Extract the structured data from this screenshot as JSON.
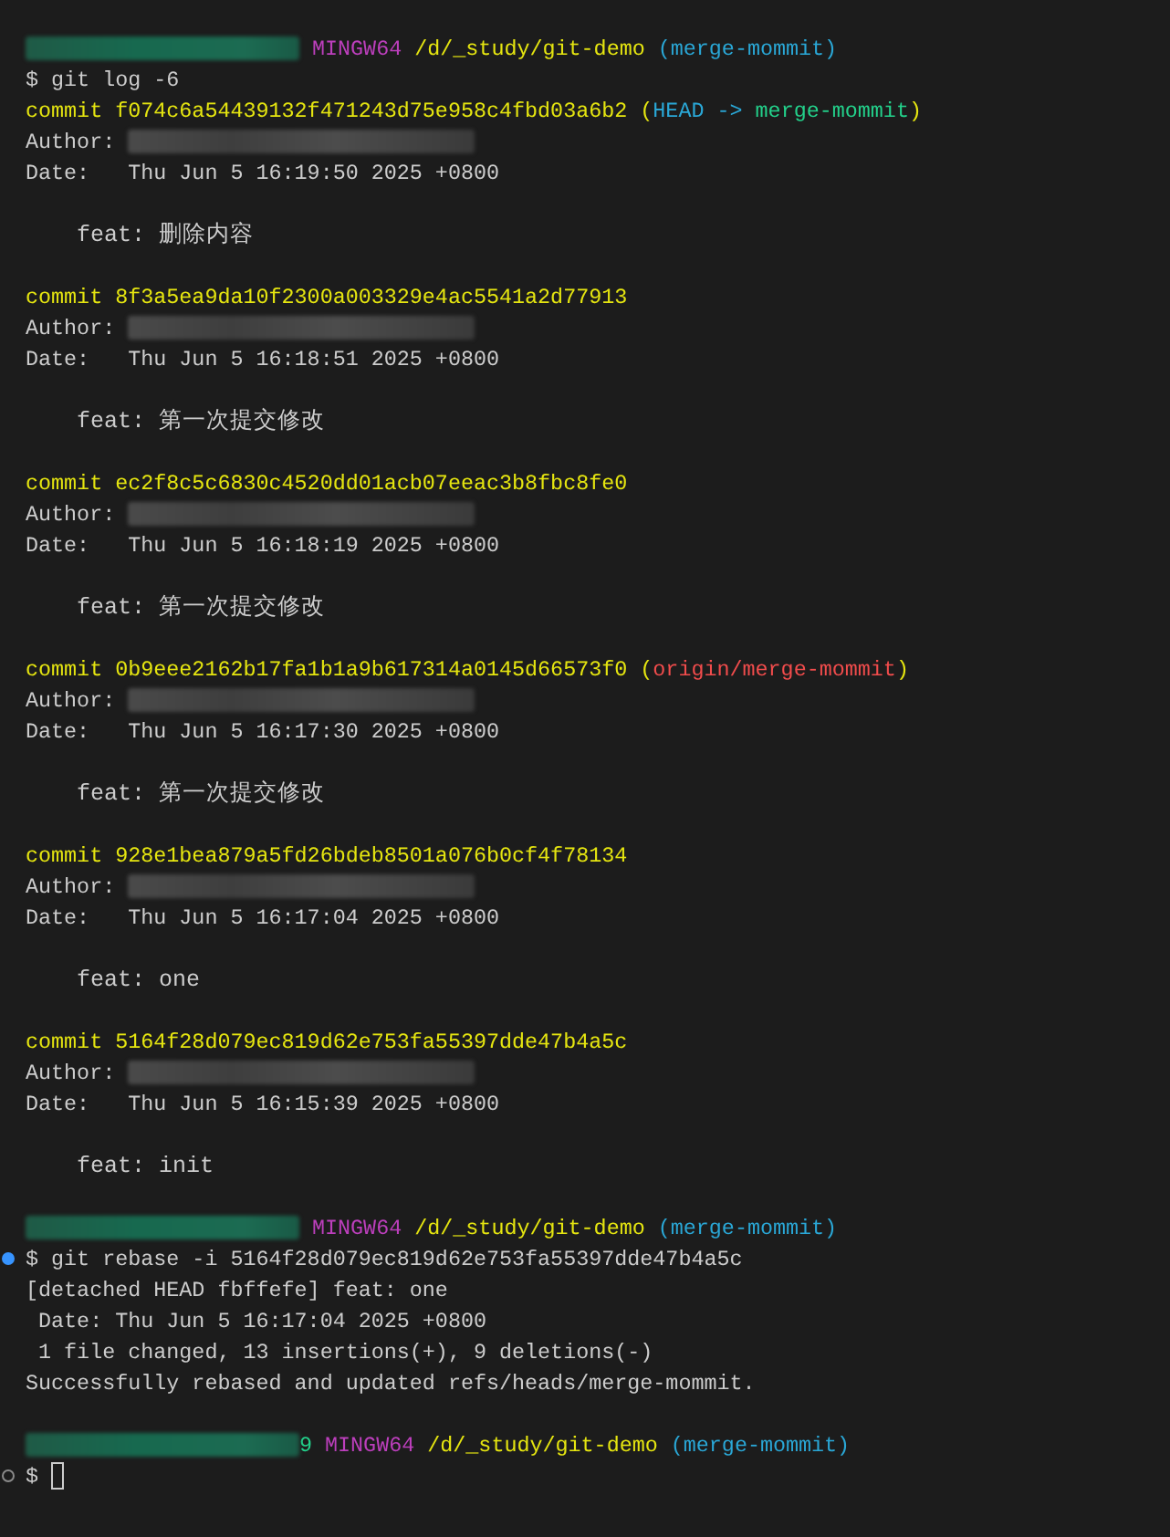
{
  "terminal": {
    "blocks": [
      {
        "kind": "prompt",
        "system": "MINGW64",
        "path": "/d/_study/git-demo",
        "branch": "(merge-mommit)"
      },
      {
        "kind": "command",
        "decorated": false,
        "text": "$ git log -6"
      },
      {
        "kind": "commit",
        "text": "commit f074c6a54439132f471243d75e958c4fbd03a6b2",
        "refs": [
          {
            "kind": "paren",
            "text": "("
          },
          {
            "kind": "head",
            "text": "HEAD ->"
          },
          {
            "kind": "local",
            "text": "merge-mommit"
          },
          {
            "kind": "paren",
            "text": ")"
          }
        ],
        "author_label": "Author:",
        "date": "Date:   Thu Jun 5 16:19:50 2025 +0800",
        "message": "feat: 删除内容"
      },
      {
        "kind": "commit",
        "text": "commit 8f3a5ea9da10f2300a003329e4ac5541a2d77913",
        "author_label": "Author:",
        "date": "Date:   Thu Jun 5 16:18:51 2025 +0800",
        "message": "feat: 第一次提交修改"
      },
      {
        "kind": "commit",
        "text": "commit ec2f8c5c6830c4520dd01acb07eeac3b8fbc8fe0",
        "author_label": "Author:",
        "date": "Date:   Thu Jun 5 16:18:19 2025 +0800",
        "message": "feat: 第一次提交修改"
      },
      {
        "kind": "commit",
        "text": "commit 0b9eee2162b17fa1b1a9b617314a0145d66573f0",
        "refs": [
          {
            "kind": "paren",
            "text": "("
          },
          {
            "kind": "remote",
            "text": "origin/merge-mommit"
          },
          {
            "kind": "paren",
            "text": ")"
          }
        ],
        "author_label": "Author:",
        "date": "Date:   Thu Jun 5 16:17:30 2025 +0800",
        "message": "feat: 第一次提交修改"
      },
      {
        "kind": "commit",
        "text": "commit 928e1bea879a5fd26bdeb8501a076b0cf4f78134",
        "author_label": "Author:",
        "date": "Date:   Thu Jun 5 16:17:04 2025 +0800",
        "message": "feat: one"
      },
      {
        "kind": "commit",
        "text": "commit 5164f28d079ec819d62e753fa55397dde47b4a5c",
        "author_label": "Author:",
        "date": "Date:   Thu Jun 5 16:15:39 2025 +0800",
        "message": "feat: init"
      },
      {
        "kind": "prompt",
        "system": "MINGW64",
        "path": "/d/_study/git-demo",
        "branch": "(merge-mommit)"
      },
      {
        "kind": "command",
        "decorated": true,
        "finished": true,
        "text": "$ git rebase -i 5164f28d079ec819d62e753fa55397dde47b4a5c"
      },
      {
        "kind": "output",
        "text": "[detached HEAD fbffefe] feat: one"
      },
      {
        "kind": "output",
        "text": " Date: Thu Jun 5 16:17:04 2025 +0800"
      },
      {
        "kind": "output",
        "text": " 1 file changed, 13 insertions(+), 9 deletions(-)"
      },
      {
        "kind": "output",
        "text": "Successfully rebased and updated refs/heads/merge-mommit."
      },
      {
        "kind": "blank"
      },
      {
        "kind": "prompt",
        "host_tail": "9",
        "system": "MINGW64",
        "path": "/d/_study/git-demo",
        "branch": "(merge-mommit)"
      },
      {
        "kind": "command",
        "decorated": true,
        "finished": false,
        "text": "$",
        "cursor": true
      }
    ]
  }
}
